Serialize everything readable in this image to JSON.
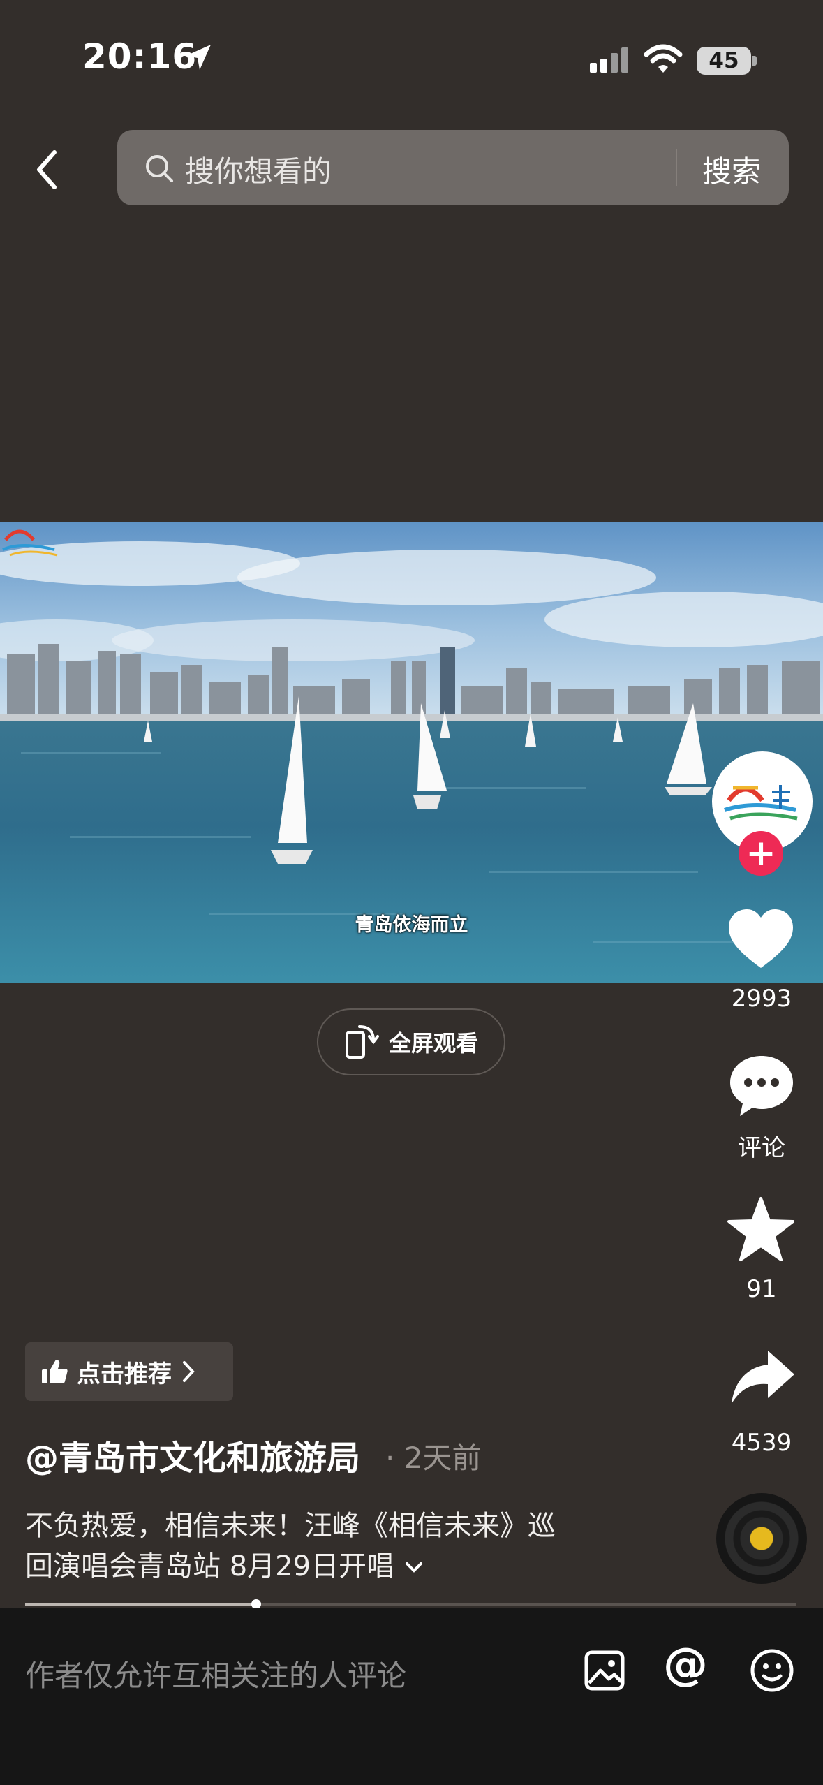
{
  "status_bar": {
    "time": "20:16",
    "battery": "45"
  },
  "header": {
    "search_placeholder": "搜你想看的",
    "search_button": "搜索"
  },
  "video": {
    "subtitle": "青岛依海而立",
    "fullscreen_label": "全屏观看"
  },
  "actions": {
    "likes": "2993",
    "comments_label": "评论",
    "favorites": "91",
    "shares": "4539"
  },
  "post": {
    "recommend_label": "点击推荐",
    "author": "@青岛市文化和旅游局",
    "time": "· 2天前",
    "caption_line1": "不负热爱，相信未来！汪峰《相信未来》巡",
    "caption_line2": "回演唱会青岛站 8月29日开唱",
    "progress_percent": 30
  },
  "comment_bar": {
    "placeholder": "作者仅允许互相关注的人评论"
  },
  "icons": [
    "location-arrow-icon",
    "signal-icon",
    "wifi-icon",
    "back-icon",
    "search-icon",
    "fullscreen-phone-icon",
    "plus-icon",
    "heart-icon",
    "comment-bubble-icon",
    "star-icon",
    "share-arrow-icon",
    "thumbs-up-icon",
    "chevron-right-icon",
    "chevron-down-icon",
    "image-icon",
    "at-icon",
    "emoji-icon"
  ],
  "colors": {
    "background": "#332e2b",
    "follow": "#ee2a55",
    "search_bar": "#6f6a67",
    "comment_bar": "#161616"
  }
}
